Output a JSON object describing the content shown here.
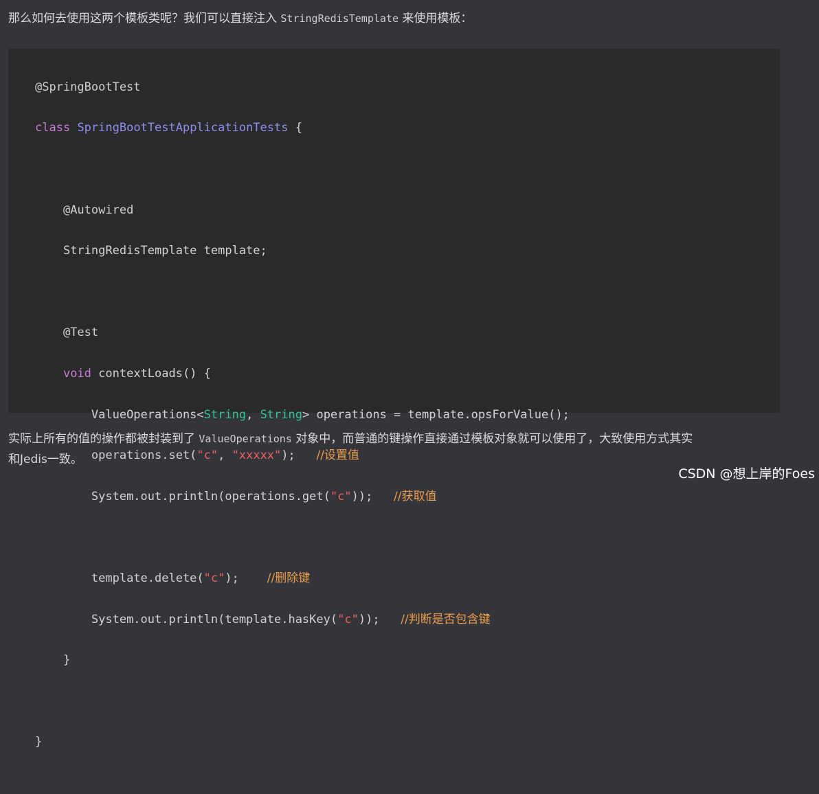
{
  "intro": {
    "text_before": "那么如何去使用这两个模板类呢？我们可以直接注入 ",
    "code": "StringRedisTemplate",
    "text_after": " 来使用模板："
  },
  "code_block": {
    "annotation_spring": "@SpringBootTest",
    "kw_class": "class",
    "class_name": "SpringBootTestApplicationTests",
    "brace_open": " {",
    "annotation_autowired": "@Autowired",
    "field_decl": "StringRedisTemplate template;",
    "annotation_test": "@Test",
    "kw_void": "void",
    "method_sig": " contextLoads() {",
    "ops_prefix": "ValueOperations<",
    "type_string_1": "String",
    "ops_sep": ", ",
    "type_string_2": "String",
    "ops_suffix": "> operations = template.opsForValue();",
    "set_prefix": "operations.set(",
    "set_key": "\"c\"",
    "set_sep": ", ",
    "set_val": "\"xxxxx\"",
    "set_suffix": ");   ",
    "set_comment": "//设置值",
    "get_prefix": "System.out.println(operations.get(",
    "get_key": "\"c\"",
    "get_suffix": "));   ",
    "get_comment": "//获取值",
    "del_prefix": "template.delete(",
    "del_key": "\"c\"",
    "del_suffix": ");    ",
    "del_comment": "//删除键",
    "has_prefix": "System.out.println(template.hasKey(",
    "has_key": "\"c\"",
    "has_suffix": "));   ",
    "has_comment": "//判断是否包含键",
    "method_close": "}",
    "class_close": "}"
  },
  "outro": {
    "text_before": "实际上所有的值的操作都被封装到了 ",
    "code": "ValueOperations",
    "text_after_line1": " 对象中，而普通的键操作直接通过模板对象就可以使用了，大致使用方式其实",
    "line2": "和Jedis一致。"
  },
  "watermark": "CSDN @想上岸的Foes"
}
